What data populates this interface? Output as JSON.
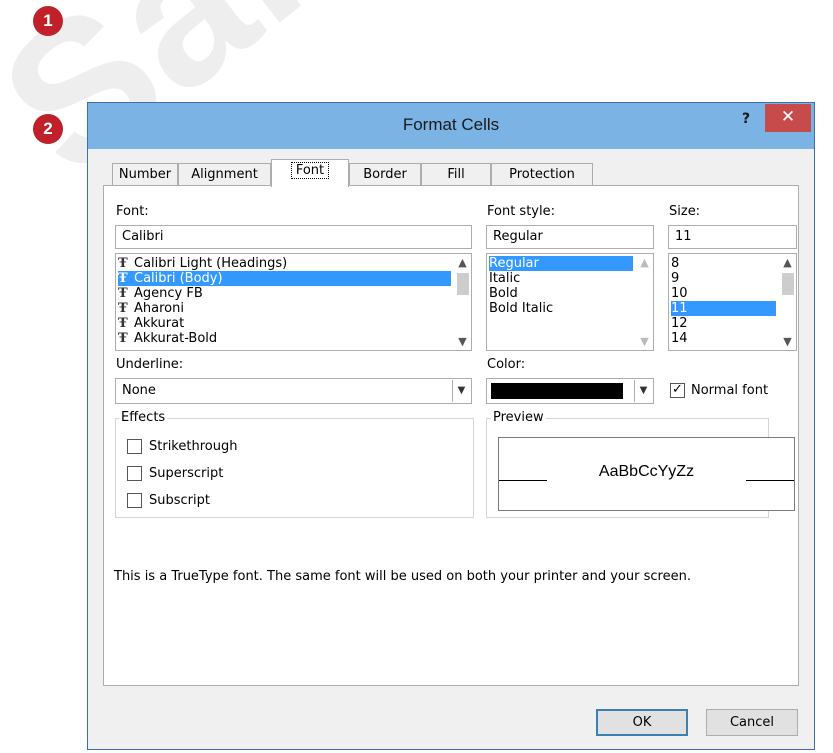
{
  "badges": [
    "1",
    "2"
  ],
  "dialog": {
    "title": "Format Cells",
    "help_label": "?",
    "close_label": "✕"
  },
  "tabs": [
    {
      "label": "Number"
    },
    {
      "label": "Alignment"
    },
    {
      "label": "Font"
    },
    {
      "label": "Border"
    },
    {
      "label": "Fill"
    },
    {
      "label": "Protection"
    }
  ],
  "active_tab": "Font",
  "font": {
    "label": "Font:",
    "value": "Calibri",
    "items": [
      "Calibri Light (Headings)",
      "Calibri (Body)",
      "Agency FB",
      "Aharoni",
      "Akkurat",
      "Akkurat-Bold"
    ],
    "selected": "Calibri (Body)",
    "icon": "truetype-icon"
  },
  "font_style": {
    "label": "Font style:",
    "value": "Regular",
    "items": [
      "Regular",
      "Italic",
      "Bold",
      "Bold Italic"
    ],
    "selected": "Regular"
  },
  "size": {
    "label": "Size:",
    "value": "11",
    "items": [
      "8",
      "9",
      "10",
      "11",
      "12",
      "14"
    ],
    "selected": "11"
  },
  "underline": {
    "label": "Underline:",
    "value": "None"
  },
  "color": {
    "label": "Color:",
    "value_color": "#000000"
  },
  "normal_font": {
    "label": "Normal font",
    "checked": true
  },
  "effects": {
    "title": "Effects",
    "options": [
      {
        "label": "Strikethrough",
        "checked": false
      },
      {
        "label": "Superscript",
        "checked": false
      },
      {
        "label": "Subscript",
        "checked": false
      }
    ]
  },
  "preview": {
    "title": "Preview",
    "sample": "AaBbCcYyZz"
  },
  "info_text": "This is a TrueType font.  The same font will be used on both your printer and your screen.",
  "buttons": {
    "ok": "OK",
    "cancel": "Cancel"
  },
  "colors": {
    "titlebar": "#7ab3e4",
    "close": "#c74b4b",
    "selection": "#3399ff",
    "badge": "#c0202a"
  }
}
